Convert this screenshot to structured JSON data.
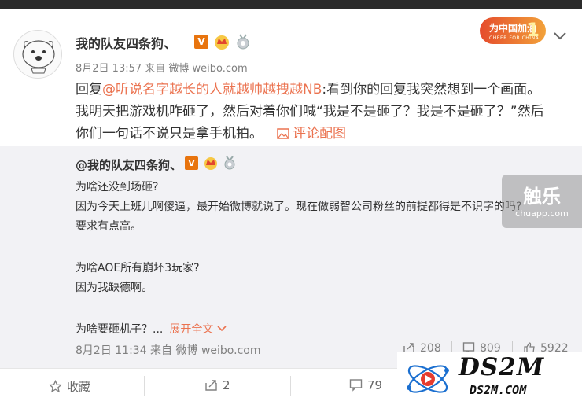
{
  "post": {
    "username": "我的队友四条狗、",
    "badge_v": "V",
    "meta": "8月2日 13:57 来自 微博 weibo.com",
    "reply_prefix": "回复",
    "mention": "@听说名字越长的人就越帅越拽越NB",
    "text_after_mention": ":看到你的回复我突然想到一个画面。",
    "line2": "我明天把游戏机咋砸了，然后对着你们喊“我是不是砸了？我是不是砸了？”然后",
    "line3": "你们一句话不说只是拿手机拍。",
    "pic_link": "评论配图"
  },
  "promo": {
    "title": "为中国加油",
    "sub": "CHEER FOR CHINA",
    "num": "1"
  },
  "repost": {
    "username": "@我的队友四条狗、",
    "badge_v": "V",
    "lines": [
      "为啥还没到场砸?",
      "因为今天上班儿啊傻逼，最开始微博就说了。现在做弱智公司粉丝的前提都得是不识字的吗?",
      "要求有点高。",
      "为啥AOE所有崩坏3玩家?",
      "因为我缺德啊。",
      "为啥要砸机子？..."
    ],
    "expand": "展开全文",
    "meta": "8月2日 11:34 来自 微博 weibo.com",
    "reposts": "208",
    "comments": "809",
    "likes": "5922"
  },
  "watermark": {
    "big": "触乐",
    "small": "chuapp.com"
  },
  "bottom": {
    "favorite": "收藏",
    "reposts": "2",
    "comments": "79"
  },
  "ds2m": {
    "title": "DS2M",
    "sub": "DS2M.COM"
  },
  "colors": {
    "accent": "#eb7350",
    "badge": "#e8740e",
    "repost_bg": "#f2f2f5"
  }
}
